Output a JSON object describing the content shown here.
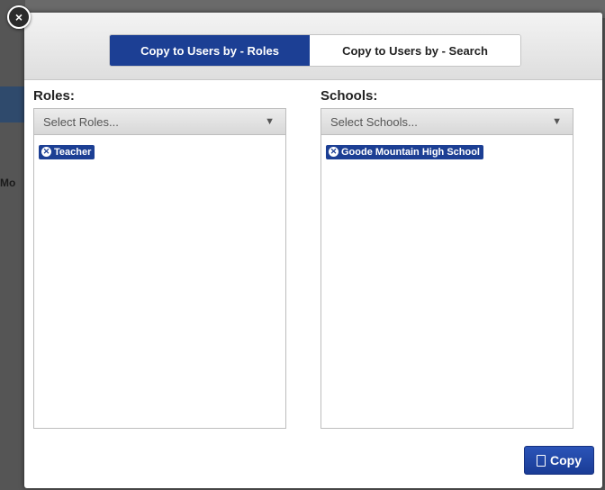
{
  "modal": {
    "close_icon": "close-icon"
  },
  "tabs": [
    {
      "label": "Copy to Users by - Roles",
      "active": true
    },
    {
      "label": "Copy to Users by - Search",
      "active": false
    }
  ],
  "roles": {
    "label": "Roles:",
    "placeholder": "Select Roles...",
    "selected": [
      "Teacher"
    ]
  },
  "schools": {
    "label": "Schools:",
    "placeholder": "Select Schools...",
    "selected": [
      "Goode Mountain High School"
    ]
  },
  "actions": {
    "copy_label": "Copy",
    "copy_icon": "copy-icon"
  },
  "colors": {
    "accent": "#1c3f94",
    "header_bg": "#e6e6e6"
  }
}
